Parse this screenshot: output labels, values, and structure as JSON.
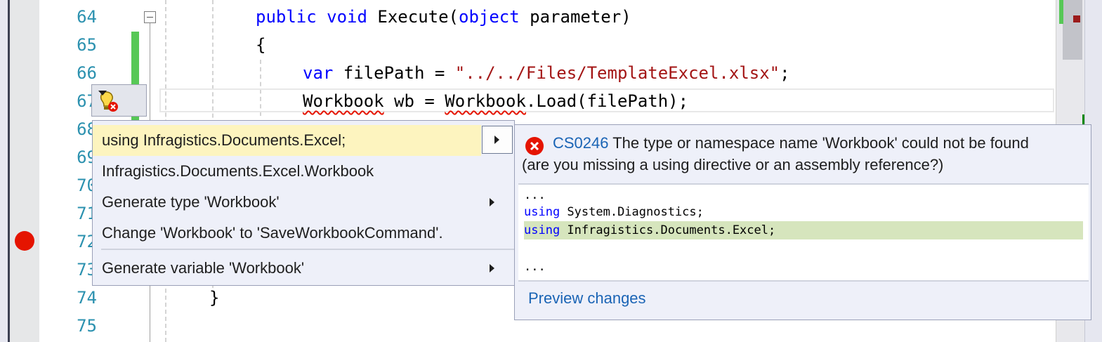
{
  "editor": {
    "line_numbers": [
      "64",
      "65",
      "66",
      "67",
      "68",
      "69",
      "70",
      "71",
      "72",
      "73",
      "74",
      "75"
    ],
    "code_lines": {
      "l64": {
        "kw1": "public",
        "sp1": " ",
        "kw2": "void",
        "rest1": " Execute(",
        "kw3": "object",
        "rest2": " parameter)"
      },
      "l65": {
        "text": "{"
      },
      "l66": {
        "kw": "var",
        "mid": " filePath = ",
        "str": "\"../../Files/TemplateExcel.xlsx\"",
        "end": ";"
      },
      "l67": {
        "t1": "Workbook",
        "t2": " wb = ",
        "t3": "Workbook",
        ".": ".",
        "t4": "Load(filePath);"
      },
      "l74": {
        "text": "}"
      }
    }
  },
  "quick_actions": {
    "bulb_icon": "lightbulb-error-icon",
    "items": [
      {
        "label": "using Infragistics.Documents.Excel;",
        "selected": true
      },
      {
        "label": "Infragistics.Documents.Excel.Workbook"
      },
      {
        "label": "Generate type 'Workbook'"
      },
      {
        "label": "Change 'Workbook' to 'SaveWorkbookCommand'."
      },
      {
        "label": "Generate variable 'Workbook'"
      }
    ]
  },
  "preview": {
    "error_code": "CS0246",
    "message_line1": "The type or namespace name 'Workbook' could not be found",
    "message_line2": "(are you missing a using directive or an assembly reference?)",
    "code": {
      "ellipsis_top": "...",
      "line1_kw": "using",
      "line1_rest": " System.Diagnostics;",
      "line2_kw": "using",
      "line2_rest": " Infragistics.Documents.Excel;",
      "ellipsis_bottom": "..."
    },
    "link": "Preview changes"
  },
  "colors": {
    "keyword": "#0000ff",
    "string": "#a31515",
    "line_number": "#2b91af",
    "breakpoint": "#e51400",
    "change_bar": "#57c856",
    "selected_item": "#fdf4bf"
  }
}
